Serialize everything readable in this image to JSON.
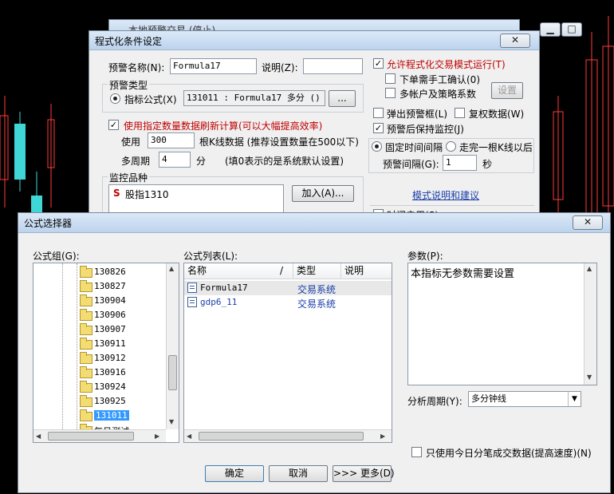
{
  "back_window": {
    "title": "本地预警交易     (停止)"
  },
  "cond_dialog": {
    "title": "程式化条件设定",
    "close": "✕",
    "alert_name_label": "预警名称(N):",
    "alert_name_value": "Formula17",
    "desc_label": "说明(Z):",
    "desc_value": "",
    "alert_type_caption": "预警类型",
    "indicator_formula_label": "指标公式(X)",
    "formula_value": "131011 : Formula17 多分 ()",
    "browse_button": "...",
    "refresh_checkbox_label": "使用指定数量数据刷新计算(可以大幅提高效率)",
    "use_label": "使用",
    "use_value": "300",
    "bars_label": "根K线数据 (推荐设置数量在500以下)",
    "multi_period_label": "多周期",
    "multi_period_value": "4",
    "minute_label": "分",
    "multi_period_note": "(填0表示的是系统默认设置)",
    "monitor_caption": "监控品种",
    "monitor_item_prefix": "S",
    "monitor_item": "股指1310",
    "add_button": "加入(A)...",
    "allow_trading_label": "允许程式化交易模式运行(T)",
    "manual_confirm_label": "下单需手工确认(0)",
    "multi_account_label": "多帐户及策略系数",
    "settings_button": "设置",
    "popup_label": "弹出预警框(L)",
    "rights_label": "复权数据(W)",
    "keep_monitor_label": "预警后保持监控(J)",
    "fixed_interval_label": "固定时间间隔",
    "after_bar_label": "走完一根K线以后",
    "alert_interval_label": "预警间隔(G):",
    "alert_interval_value": "1",
    "seconds_label": "秒",
    "mode_link": "模式说明和建议",
    "cut_label": "时间启用(S)"
  },
  "formula_dialog": {
    "title": "公式选择器",
    "close": "✕",
    "group_label": "公式组(G):",
    "tree_items": [
      "130826",
      "130827",
      "130904",
      "130906",
      "130907",
      "130911",
      "130912",
      "130916",
      "130924",
      "130925",
      "131011",
      "每日测试"
    ],
    "selected_tree_index": 10,
    "list_label": "公式列表(L):",
    "columns": {
      "name": "名称",
      "sort": "/",
      "type": "类型",
      "desc": "说明"
    },
    "rows": [
      {
        "name": "Formula17",
        "type": "交易系统"
      },
      {
        "name": "gdp6_11",
        "type": "交易系统"
      }
    ],
    "params_label": "参数(P):",
    "params_text": "本指标无参数需要设置",
    "period_label": "分析周期(Y):",
    "period_value": "多分钟线",
    "tick_checkbox_label": "只使用今日分笔成交数据(提高速度)(N)",
    "ok_button": "确定",
    "cancel_button": "取消",
    "more_button": ">>> 更多(D)"
  },
  "colors": {
    "bull": "#ff3a3a",
    "bear": "#3fd6d6",
    "title_gradient": "#bcd3ee",
    "selection": "#3399ff"
  }
}
